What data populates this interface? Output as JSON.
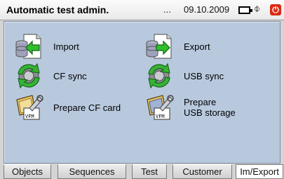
{
  "header": {
    "title": "Automatic test admin.",
    "ellipsis": "...",
    "date": "09.10.2009",
    "icons": [
      "battery-icon",
      "plug-icon",
      "power-icon"
    ],
    "power_glyph": "⏻"
  },
  "actions": [
    {
      "label": "Import",
      "icon": "import-icon"
    },
    {
      "label": "Export",
      "icon": "export-icon"
    },
    {
      "label": "CF sync",
      "icon": "sync-icon"
    },
    {
      "label": "USB sync",
      "icon": "sync-icon"
    },
    {
      "label_lines": [
        "Prepare CF card"
      ],
      "icon": "prepare-card-icon"
    },
    {
      "label_lines": [
        "Prepare",
        "USB storage"
      ],
      "icon": "prepare-usb-icon"
    }
  ],
  "tabs": [
    {
      "label": "Objects",
      "active": false
    },
    {
      "label": "Sequences",
      "active": false
    },
    {
      "label": "Test",
      "active": false
    },
    {
      "label": "Customer",
      "active": false
    },
    {
      "label": "Im/Export",
      "active": true
    }
  ],
  "colors": {
    "panel_bg": "#b8c9de",
    "power_red": "#d92a14",
    "arrow_green": "#2fbf2f"
  }
}
